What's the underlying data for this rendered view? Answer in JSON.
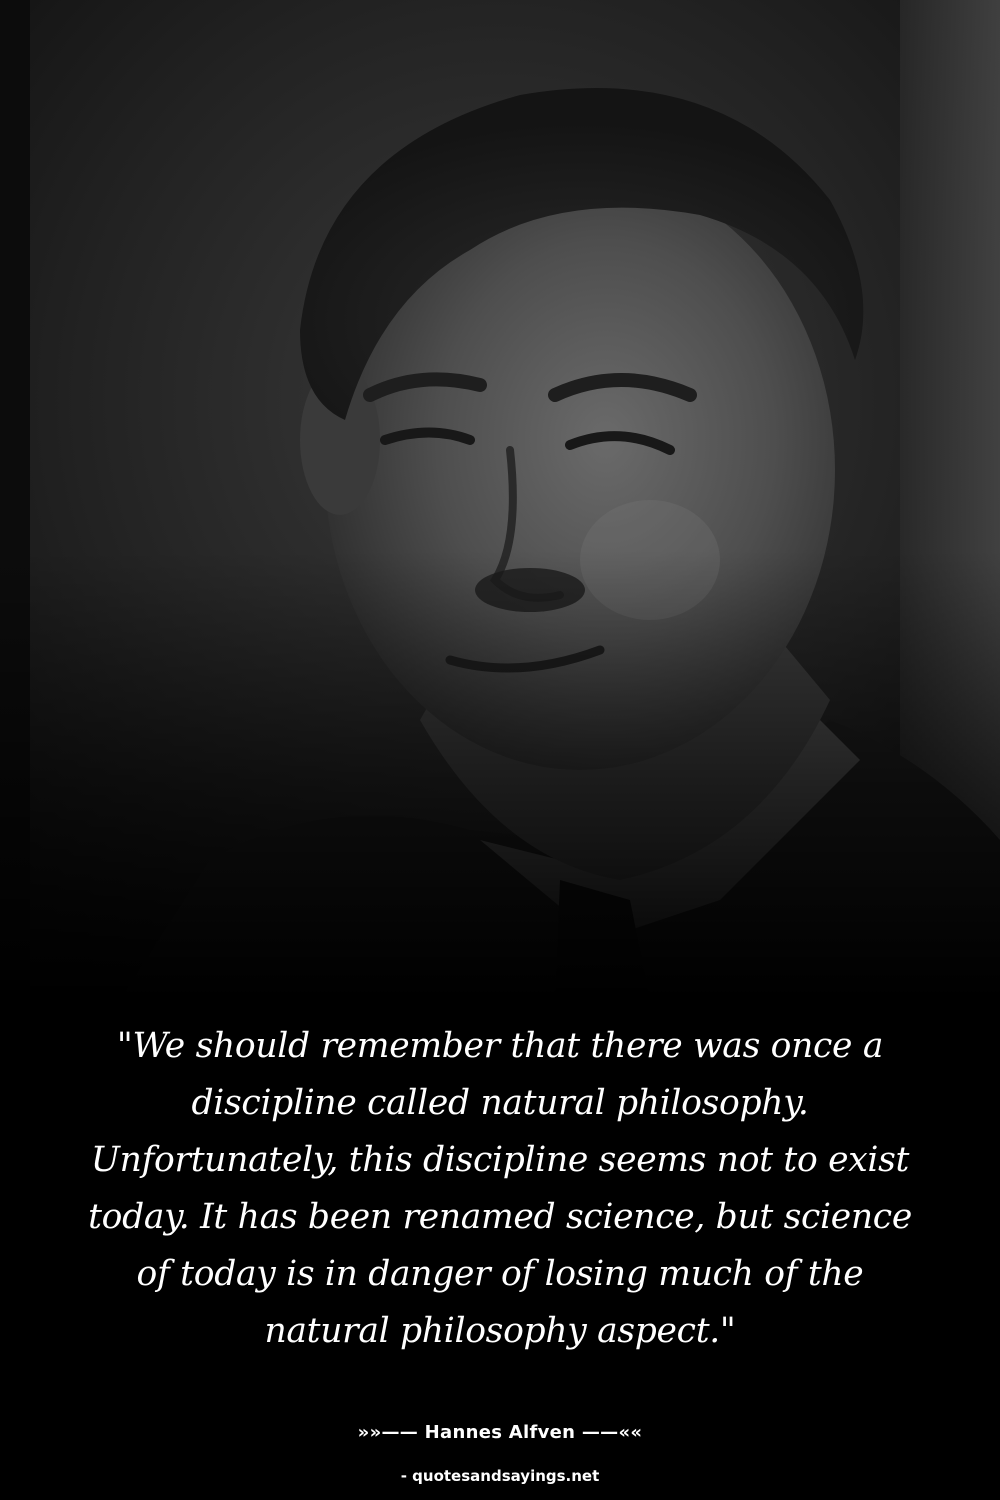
{
  "quote": {
    "text": "\"We should remember that there was once a discipline called natural philosophy. Unfortunately, this discipline seems not to exist today. It has been renamed science, but science of today is in danger of losing much of the natural philosophy aspect.\""
  },
  "attribution": {
    "author_line": "»»—— Hannes Alfven ——««"
  },
  "footer": {
    "source": "- quotesandsayings.net"
  },
  "colors": {
    "background": "#000000",
    "text": "#ffffff"
  }
}
